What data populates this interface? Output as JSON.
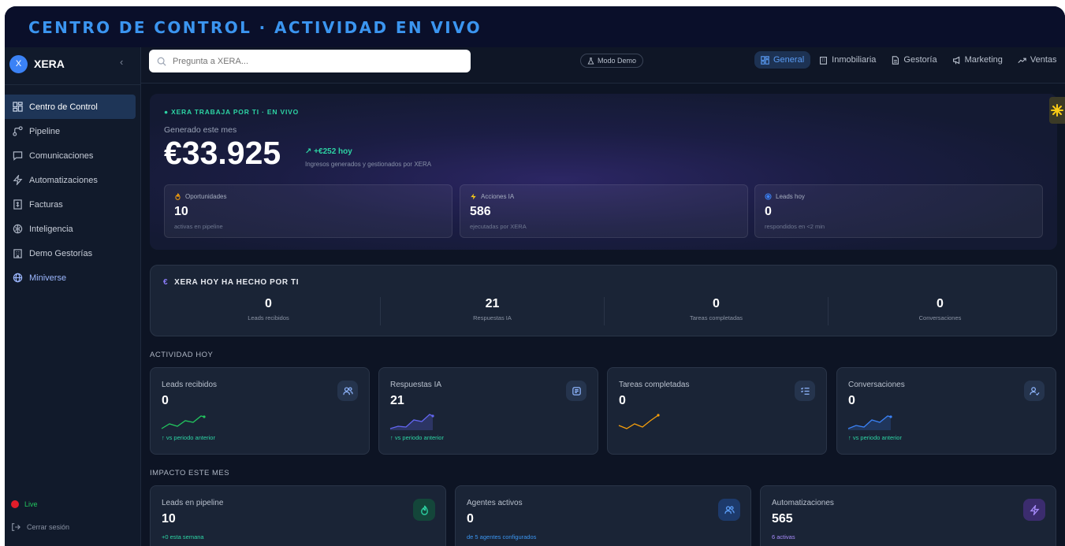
{
  "banner": {
    "title": "CENTRO DE CONTROL · ACTIVIDAD EN VIVO"
  },
  "brand": {
    "logo": "X",
    "name": "XERA",
    "collapse": "‹"
  },
  "sidebar": {
    "items": [
      {
        "label": "Centro de Control",
        "icon": "dashboard-icon"
      },
      {
        "label": "Pipeline",
        "icon": "pipeline-icon"
      },
      {
        "label": "Comunicaciones",
        "icon": "chat-icon"
      },
      {
        "label": "Automatizaciones",
        "icon": "bolt-icon"
      },
      {
        "label": "Facturas",
        "icon": "invoice-icon"
      },
      {
        "label": "Inteligencia",
        "icon": "brain-icon"
      },
      {
        "label": "Demo Gestorías",
        "icon": "building-icon"
      },
      {
        "label": "Miniverse",
        "icon": "globe-icon"
      }
    ],
    "live": "Live",
    "logout": "Cerrar sesión"
  },
  "topbar": {
    "search_placeholder": "Pregunta a XERA...",
    "demo_badge": "Modo Demo",
    "tabs": [
      {
        "label": "General"
      },
      {
        "label": "Inmobiliaria"
      },
      {
        "label": "Gestoría"
      },
      {
        "label": "Marketing"
      },
      {
        "label": "Ventas"
      }
    ]
  },
  "hero": {
    "live_label": "● XERA TRABAJA POR TI · EN VIVO",
    "subtitle": "Generado este mes",
    "amount": "€33.925",
    "delta": "+€252 hoy",
    "note": "Ingresos generados y gestionados por XERA",
    "minis": [
      {
        "label": "Oportunidades",
        "value": "10",
        "desc": "activas en pipeline",
        "color": "#f59e0b"
      },
      {
        "label": "Acciones IA",
        "value": "586",
        "desc": "ejecutadas por XERA",
        "color": "#facc15"
      },
      {
        "label": "Leads hoy",
        "value": "0",
        "desc": "respondidos en <2 min",
        "color": "#3b82f6"
      }
    ]
  },
  "today": {
    "symbol": "€",
    "title": "XERA HOY HA HECHO POR TI",
    "stats": [
      {
        "value": "0",
        "label": "Leads recibidos"
      },
      {
        "value": "21",
        "label": "Respuestas IA"
      },
      {
        "value": "0",
        "label": "Tareas completadas"
      },
      {
        "value": "0",
        "label": "Conversaciones"
      }
    ]
  },
  "activity": {
    "title": "ACTIVIDAD HOY",
    "cards": [
      {
        "label": "Leads recibidos",
        "value": "0",
        "foot": "↑ vs periodo anterior",
        "spark_color": "#22c55e",
        "icon": "users-icon"
      },
      {
        "label": "Respuestas IA",
        "value": "21",
        "foot": "↑ vs periodo anterior",
        "spark_color": "#6366f1",
        "icon": "message-icon"
      },
      {
        "label": "Tareas completadas",
        "value": "0",
        "foot": "",
        "spark_color": "#f59e0b",
        "icon": "checklist-icon"
      },
      {
        "label": "Conversaciones",
        "value": "0",
        "foot": "↑ vs periodo anterior",
        "spark_color": "#3b82f6",
        "icon": "user-check-icon"
      }
    ]
  },
  "impact": {
    "title": "IMPACTO ESTE MES",
    "cards": [
      {
        "label": "Leads en pipeline",
        "value": "10",
        "foot": "+0 esta semana",
        "foot_color": "#2dd4a4",
        "icon": "flame-icon",
        "icon_bg": "#14463a",
        "icon_color": "#2dd4a4"
      },
      {
        "label": "Agentes activos",
        "value": "0",
        "foot": "de 5 agentes configurados",
        "foot_color": "#3b95f0",
        "icon": "users-icon",
        "icon_bg": "#1d3a6b",
        "icon_color": "#5a9cf5"
      },
      {
        "label": "Automatizaciones",
        "value": "565",
        "foot": "6 activas",
        "foot_color": "#a78bfa",
        "icon": "bolt-icon",
        "icon_bg": "#3b2c6e",
        "icon_color": "#a78bfa"
      }
    ]
  }
}
